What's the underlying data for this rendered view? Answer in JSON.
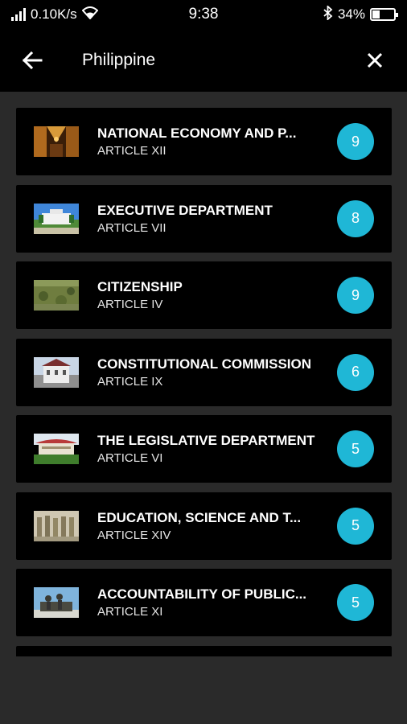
{
  "status": {
    "speed": "0.10K/s",
    "time": "9:38",
    "battery": "34%",
    "battery_level": 0.34,
    "icons": [
      "signal-icon",
      "wifi-icon",
      "bluetooth-icon",
      "battery-icon"
    ]
  },
  "app_bar": {
    "title": "Philippine",
    "back_icon": "arrow-left-icon",
    "close_icon": "close-icon"
  },
  "items": [
    {
      "title": "NATIONAL ECONOMY AND P...",
      "article": "ARTICLE XII",
      "count": "9",
      "thumb": "street-photo"
    },
    {
      "title": "EXECUTIVE DEPARTMENT",
      "article": "ARTICLE VII",
      "count": "8",
      "thumb": "palace-photo"
    },
    {
      "title": "CITIZENSHIP",
      "article": "ARTICLE IV",
      "count": "9",
      "thumb": "field-photo"
    },
    {
      "title": "CONSTITUTIONAL COMMISSION",
      "article": "ARTICLE IX",
      "count": "6",
      "thumb": "building-photo"
    },
    {
      "title": "THE LEGISLATIVE DEPARTMENT",
      "article": "ARTICLE VI",
      "count": "5",
      "thumb": "congress-photo"
    },
    {
      "title": "EDUCATION, SCIENCE AND T...",
      "article": "ARTICLE XIV",
      "count": "5",
      "thumb": "statues-photo"
    },
    {
      "title": "ACCOUNTABILITY OF PUBLIC...",
      "article": "ARTICLE XI",
      "count": "5",
      "thumb": "monument-photo"
    }
  ],
  "colors": {
    "badge": "#1fb7d6",
    "card": "#000000",
    "background": "#2a2a2a"
  }
}
